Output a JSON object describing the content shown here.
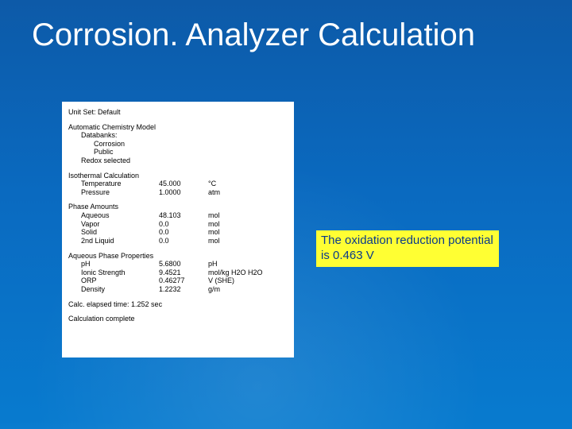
{
  "title": "Corrosion. Analyzer Calculation",
  "panel": {
    "unit_set_line": "Unit Set: Default",
    "model_header": "Automatic Chemistry Model",
    "databanks_label": "Databanks:",
    "db1": "Corrosion",
    "db2": "Public",
    "redox_line": "Redox selected",
    "iso_header": "Isothermal Calculation",
    "temperature_label": "Temperature",
    "temperature_value": "45.000",
    "temperature_unit": "°C",
    "pressure_label": "Pressure",
    "pressure_value": "1.0000",
    "pressure_unit": "atm",
    "phase_header": "Phase Amounts",
    "aqueous_label": "Aqueous",
    "aqueous_value": "48.103",
    "aqueous_unit": "mol",
    "vapor_label": "Vapor",
    "vapor_value": "0.0",
    "vapor_unit": "mol",
    "solid_label": "Solid",
    "solid_value": "0.0",
    "solid_unit": "mol",
    "liq2_label": "2nd Liquid",
    "liq2_value": "0.0",
    "liq2_unit": "mol",
    "aq_props_header": "Aqueous Phase Properties",
    "ph_label": "pH",
    "ph_value": "5.6800",
    "ph_unit": "pH",
    "ionic_label": "Ionic Strength",
    "ionic_value": "9.4521",
    "ionic_unit": "mol/kg H2O H2O",
    "orp_label": "ORP",
    "orp_value": "0.46277",
    "orp_unit": "V (SHE)",
    "density_label": "Density",
    "density_value": "1.2232",
    "density_unit": "g/m",
    "elapsed_line": "Calc. elapsed time: 1.252 sec",
    "complete_line": "Calculation complete"
  },
  "callout": {
    "text": "The oxidation reduction potential is 0.463 V"
  }
}
